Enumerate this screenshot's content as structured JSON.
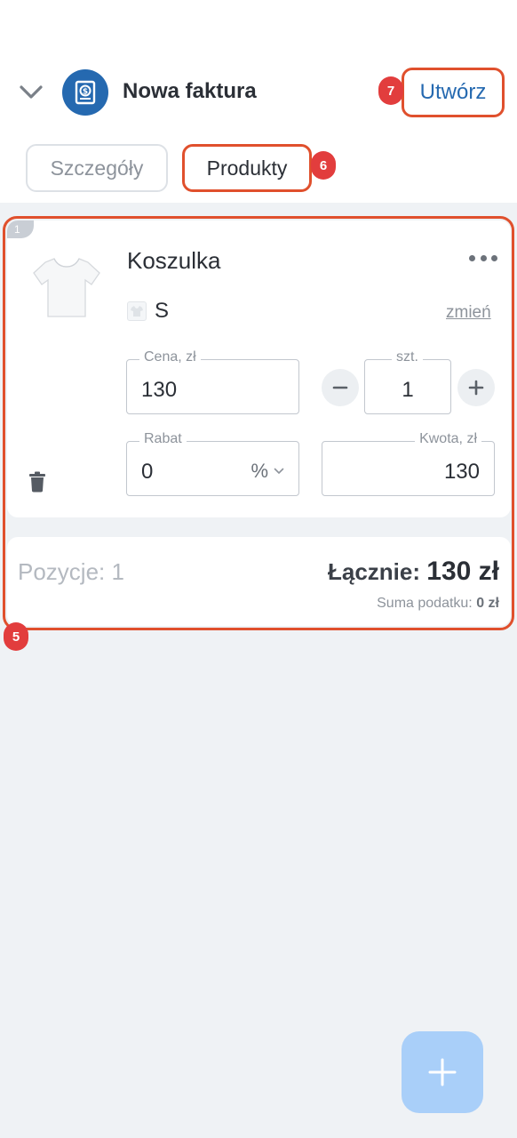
{
  "header": {
    "title": "Nowa faktura",
    "create_label": "Utwórz",
    "back_icon": "chevron-down-icon",
    "logo_icon": "invoice-document-icon"
  },
  "tabs": [
    {
      "label": "Szczegóły",
      "active": false
    },
    {
      "label": "Produkty",
      "active": true
    }
  ],
  "markers": {
    "create": "7",
    "products_tab": "6",
    "product_section": "5"
  },
  "product": {
    "index": "1",
    "name": "Koszulka",
    "variant": "S",
    "change_label": "zmień",
    "price_label": "Cena, zł",
    "price_value": "130",
    "qty_label": "szt.",
    "qty_value": "1",
    "discount_label": "Rabat",
    "discount_value": "0",
    "discount_unit": "%",
    "amount_label": "Kwota, zł",
    "amount_value": "130"
  },
  "summary": {
    "positions": "Pozycje: 1",
    "total_label": "Łącznie:",
    "total_value": "130 zł",
    "tax_label": "Suma podatku:",
    "tax_value": "0 zł"
  },
  "colors": {
    "accent": "#2569b0",
    "highlight": "#e0502d",
    "marker": "#e23d3d",
    "fab": "#a9cff9",
    "background": "#eff2f5"
  }
}
